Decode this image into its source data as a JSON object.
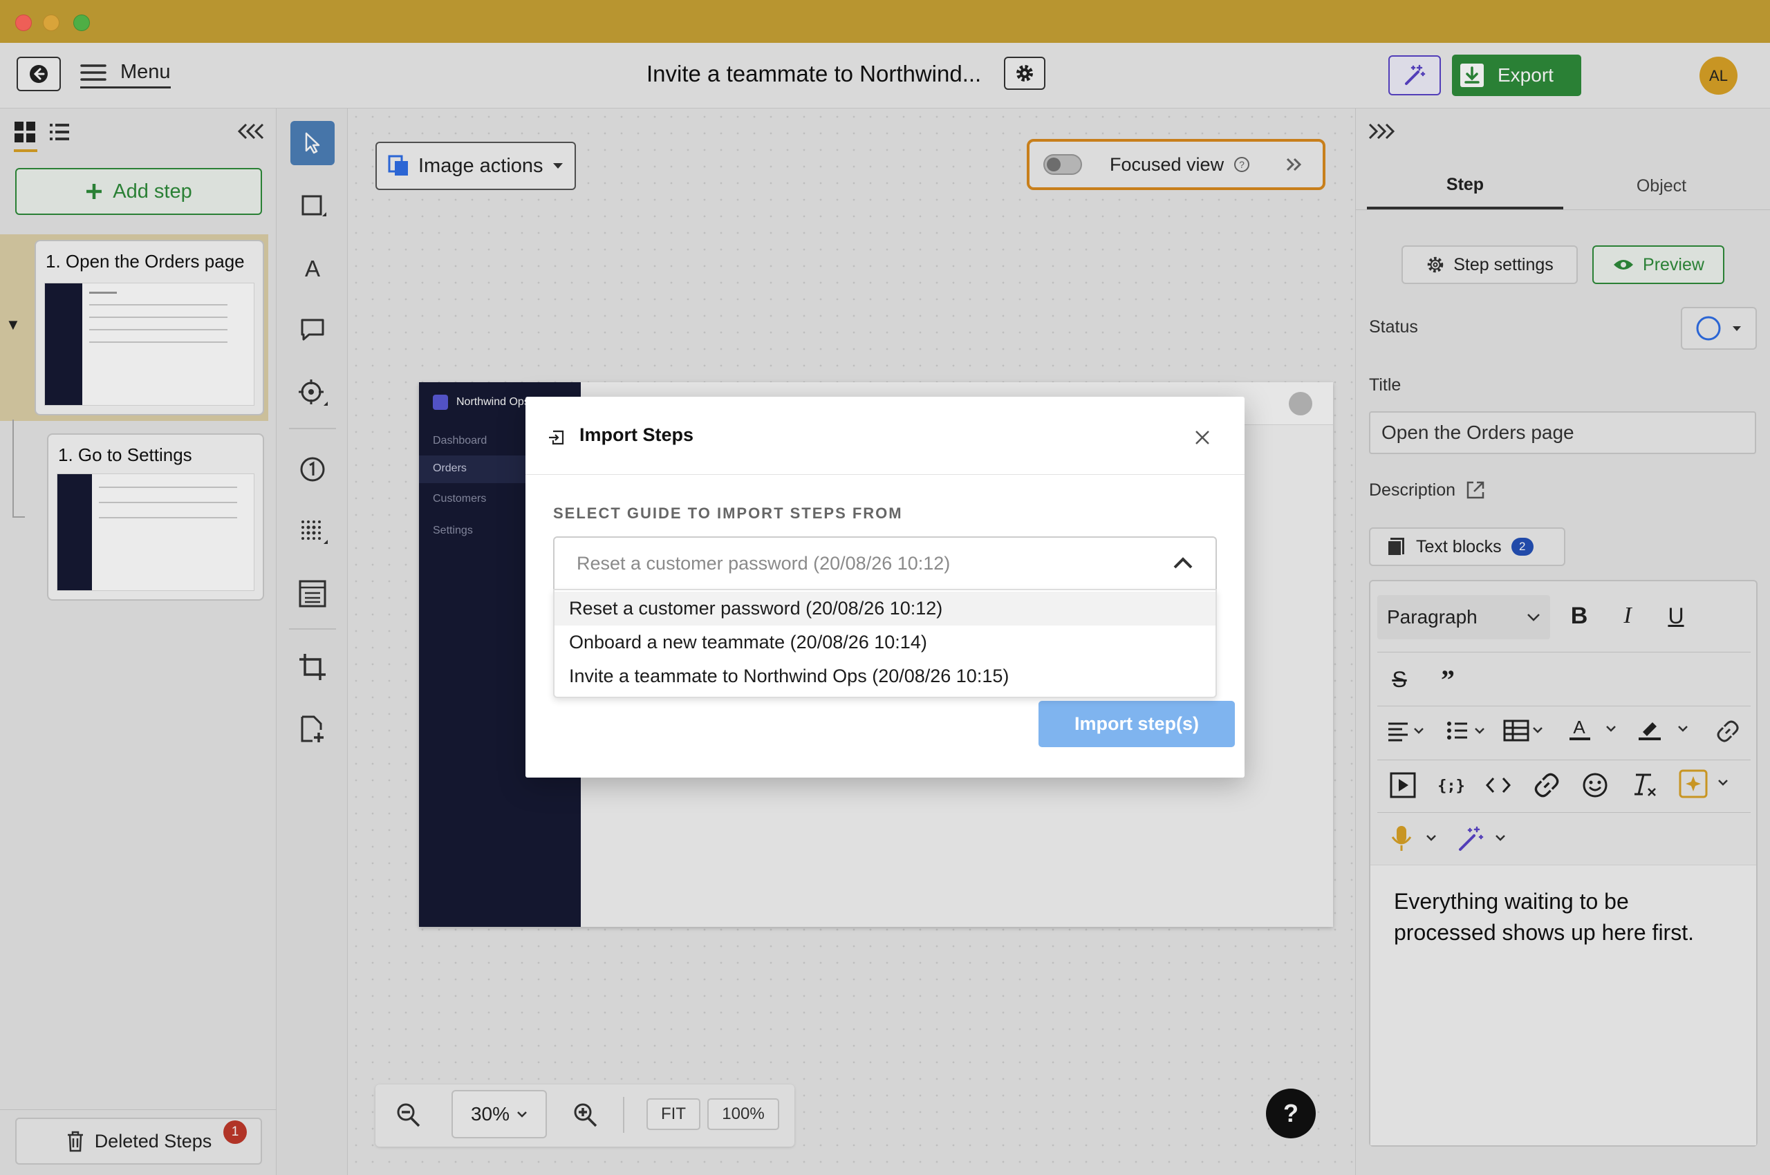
{
  "header": {
    "menu_label": "Menu",
    "title": "Invite a teammate to Northwind...",
    "export_label": "Export",
    "avatar_initials": "AL"
  },
  "left_panel": {
    "add_step_label": "Add step",
    "steps": [
      {
        "title": "1. Open the Orders page"
      },
      {
        "title": "1. Go to Settings"
      }
    ],
    "deleted_label": "Deleted Steps",
    "deleted_count": "1"
  },
  "canvas": {
    "image_actions_label": "Image actions",
    "focused_view_label": "Focused view",
    "zoom_level": "30%",
    "fit_label": "FIT",
    "full_label": "100%",
    "help_label": "?",
    "preview": {
      "brand": "Northwind Ops",
      "nav": [
        "Dashboard",
        "Orders",
        "Customers",
        "Settings"
      ]
    }
  },
  "modal": {
    "title": "Import Steps",
    "section_label": "SELECT GUIDE TO IMPORT STEPS FROM",
    "selected": "Reset a customer password (20/08/26 10:12)",
    "options": [
      "Reset a customer password (20/08/26 10:12)",
      "Onboard a new teammate (20/08/26 10:14)",
      "Invite a teammate to Northwind Ops (20/08/26 10:15)"
    ],
    "import_label": "Import step(s)"
  },
  "right_panel": {
    "tabs": [
      "Step",
      "Object"
    ],
    "step_settings_label": "Step settings",
    "preview_label": "Preview",
    "status_label": "Status",
    "title_label": "Title",
    "title_value": "Open the Orders page",
    "description_label": "Description",
    "text_blocks_label": "Text blocks",
    "text_blocks_count": "2",
    "paragraph_label": "Paragraph",
    "editor_text": "Everything waiting to be processed shows up here first."
  },
  "colors": {
    "titlebar": "#b89530",
    "accent_green": "#2e8b3a",
    "accent_blue": "#2f6ee6",
    "focused_border": "#d98a1e",
    "import_button": "#7fb4ef",
    "sidebar_dark": "#161a33",
    "badge_red": "#c0392b"
  }
}
